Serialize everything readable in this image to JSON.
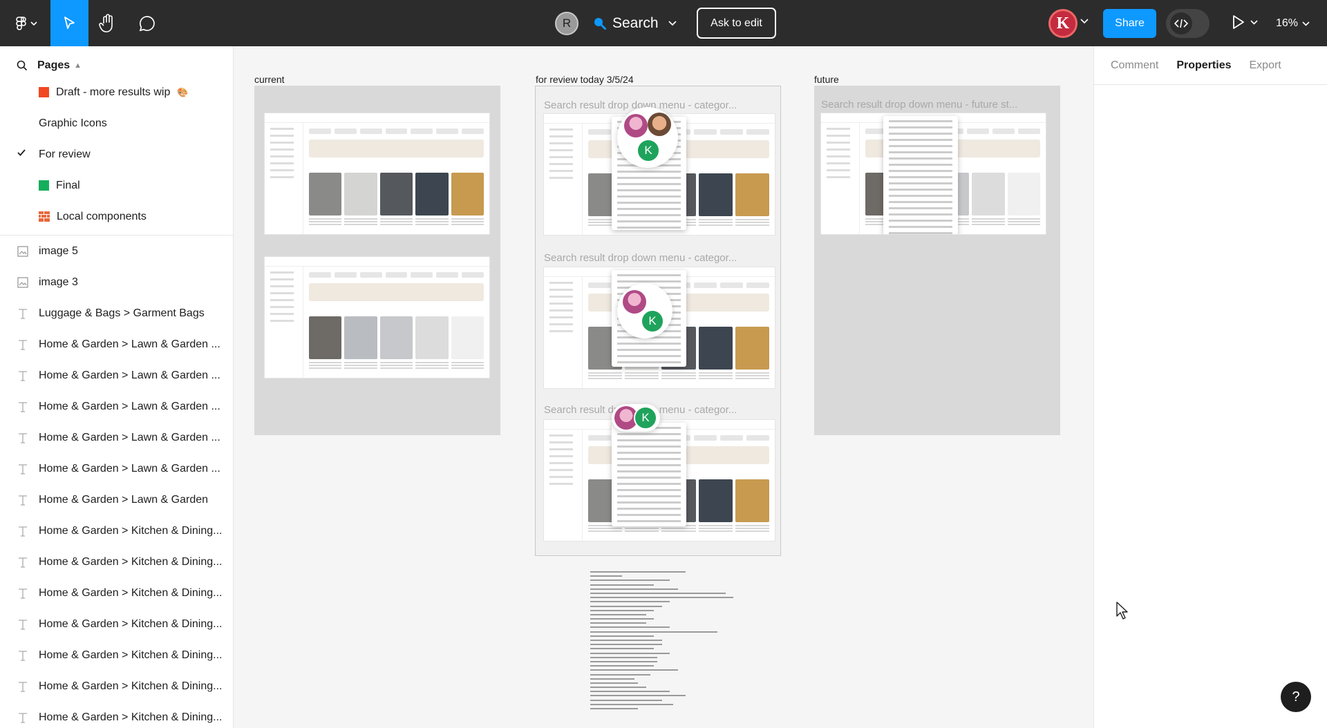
{
  "toolbar": {
    "search_label": "Search",
    "ask_to_edit": "Ask to edit",
    "share": "Share",
    "zoom": "16%",
    "user_initial_r": "R",
    "user_initial_k": "K"
  },
  "pages": {
    "header": "Pages",
    "items": [
      {
        "label": "Draft - more results wip",
        "color": "#f24822",
        "emoji": "🎨"
      },
      {
        "label": "Graphic Icons"
      },
      {
        "label": "For review",
        "current": true
      },
      {
        "label": "Final",
        "color": "#14ae5c"
      },
      {
        "label": "Local components"
      }
    ]
  },
  "layers": [
    {
      "icon": "image-icon",
      "label": "image 5"
    },
    {
      "icon": "image-icon",
      "label": "image 3"
    },
    {
      "icon": "text-icon",
      "label": "Luggage & Bags > Garment Bags"
    },
    {
      "icon": "text-icon",
      "label": "Home & Garden > Lawn & Garden ..."
    },
    {
      "icon": "text-icon",
      "label": "Home & Garden > Lawn & Garden ..."
    },
    {
      "icon": "text-icon",
      "label": "Home & Garden > Lawn & Garden ..."
    },
    {
      "icon": "text-icon",
      "label": "Home & Garden > Lawn & Garden ..."
    },
    {
      "icon": "text-icon",
      "label": "Home & Garden > Lawn & Garden ..."
    },
    {
      "icon": "text-icon",
      "label": "Home & Garden > Lawn & Garden"
    },
    {
      "icon": "text-icon",
      "label": "Home & Garden > Kitchen & Dining..."
    },
    {
      "icon": "text-icon",
      "label": "Home & Garden > Kitchen & Dining..."
    },
    {
      "icon": "text-icon",
      "label": "Home & Garden > Kitchen & Dining..."
    },
    {
      "icon": "text-icon",
      "label": "Home & Garden > Kitchen & Dining..."
    },
    {
      "icon": "text-icon",
      "label": "Home & Garden > Kitchen & Dining..."
    },
    {
      "icon": "text-icon",
      "label": "Home & Garden > Kitchen & Dining..."
    },
    {
      "icon": "text-icon",
      "label": "Home & Garden > Kitchen & Dining..."
    }
  ],
  "right_panel": {
    "tabs": [
      "Comment",
      "Properties",
      "Export"
    ],
    "active_tab": "Properties",
    "help": "?"
  },
  "canvas": {
    "frames": [
      {
        "label": "current"
      },
      {
        "label": "for review today 3/5/24"
      },
      {
        "label": "future"
      }
    ],
    "review_subtitles": [
      "Search result drop down menu - categor...",
      "Search result drop down menu - categor...",
      "Search result drop down menu - categor..."
    ],
    "future_subtitle": "Search result drop down menu - future st...",
    "collaborator_initial": "K"
  },
  "colors": {
    "toolbar_bg": "#2c2c2c",
    "accent": "#0d99ff",
    "collaborator": "#1fa35c"
  }
}
